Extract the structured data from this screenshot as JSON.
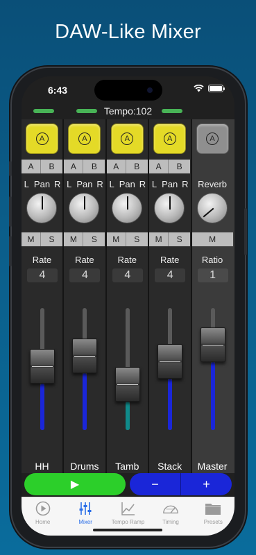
{
  "promo": {
    "title": "DAW-Like Mixer"
  },
  "status_bar": {
    "time": "6:43"
  },
  "header": {
    "tempo": "Tempo:102"
  },
  "strips": [
    {
      "name": "HH",
      "rec_label": "A",
      "ab": [
        "A",
        "B"
      ],
      "pan_label": "Pan",
      "pan_left": "L",
      "pan_right": "R",
      "mute": "M",
      "solo": "S",
      "param_label": "Rate",
      "param_value": "4",
      "fader_level": 0.52
    },
    {
      "name": "Drums",
      "rec_label": "A",
      "ab": [
        "A",
        "B"
      ],
      "pan_label": "Pan",
      "pan_left": "L",
      "pan_right": "R",
      "mute": "M",
      "solo": "S",
      "param_label": "Rate",
      "param_value": "4",
      "fader_level": 0.62
    },
    {
      "name": "Tamb",
      "rec_label": "A",
      "ab": [
        "A",
        "B"
      ],
      "pan_label": "Pan",
      "pan_left": "L",
      "pan_right": "R",
      "mute": "M",
      "solo": "S",
      "param_label": "Rate",
      "param_value": "4",
      "fader_level": 0.35
    },
    {
      "name": "Stack",
      "rec_label": "A",
      "ab": [
        "A",
        "B"
      ],
      "pan_label": "Pan",
      "pan_left": "L",
      "pan_right": "R",
      "mute": "M",
      "solo": "S",
      "param_label": "Rate",
      "param_value": "4",
      "fader_level": 0.57
    }
  ],
  "master": {
    "name": "Master",
    "rec_label": "A",
    "knob_label": "Reverb",
    "mute": "M",
    "param_label": "Ratio",
    "param_value": "1",
    "fader_level": 0.73
  },
  "transport": {
    "play": "▶",
    "minus": "−",
    "plus": "+"
  },
  "tabs": [
    {
      "label": "Home",
      "icon": "play-circle-icon",
      "active": false
    },
    {
      "label": "Mixer",
      "icon": "sliders-icon",
      "active": true
    },
    {
      "label": "Tempo Ramp",
      "icon": "chart-line-icon",
      "active": false
    },
    {
      "label": "Timing",
      "icon": "gauge-icon",
      "active": false
    },
    {
      "label": "Presets",
      "icon": "folder-icon",
      "active": false
    }
  ],
  "colors": {
    "rec_yellow": "#e4da27",
    "fader_blue": "#1a26d8",
    "fader_teal": "#0f8a8a",
    "play_green": "#2ccf2a",
    "active_tab": "#2a6ee8"
  }
}
